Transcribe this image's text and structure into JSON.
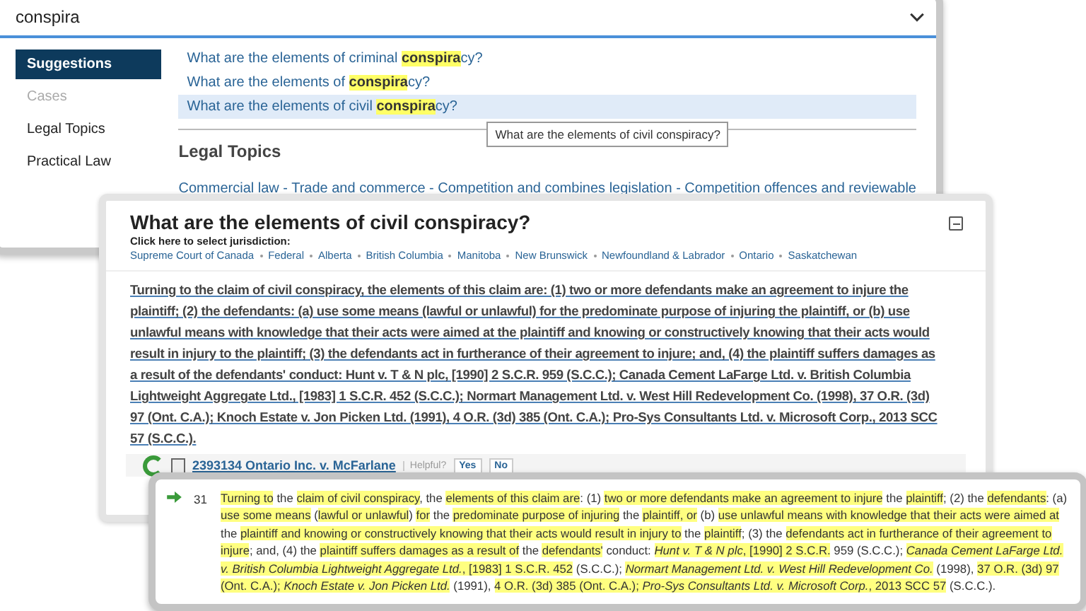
{
  "search_panel": {
    "query": "conspira",
    "categories": [
      {
        "label": "Suggestions",
        "selected": true,
        "disabled": false
      },
      {
        "label": "Cases",
        "selected": false,
        "disabled": true
      },
      {
        "label": "Legal Topics",
        "selected": false,
        "disabled": false
      },
      {
        "label": "Practical Law",
        "selected": false,
        "disabled": false
      }
    ],
    "suggestions": [
      {
        "before": "What are the elements of criminal ",
        "match": "conspira",
        "after": "cy?",
        "selected": false
      },
      {
        "before": "What are the elements of ",
        "match": "conspira",
        "after": "cy?",
        "selected": false
      },
      {
        "before": "What are the elements of civil ",
        "match": "conspira",
        "after": "cy?",
        "selected": true
      }
    ],
    "tooltip": "What are the elements of civil conspiracy?",
    "section_heading": "Legal Topics",
    "topic_link": "Commercial law - Trade and commerce - Competition and combines legislation - Competition offences and reviewable"
  },
  "answer_panel": {
    "title": "What are the elements of civil conspiracy?",
    "jurisdiction_prompt": "Click here to select jurisdiction:",
    "jurisdictions": [
      "Supreme Court of Canada",
      "Federal",
      "Alberta",
      "British Columbia",
      "Manitoba",
      "New Brunswick",
      "Newfoundland & Labrador",
      "Ontario",
      "Saskatchewan"
    ],
    "answer": "Turning to the claim of civil conspiracy, the elements of this claim are: (1) two or more defendants make an agreement to injure the plaintiff; (2) the defendants: (a) use some means (lawful or unlawful) for the predominate purpose of injuring the plaintiff, or (b) use unlawful means with knowledge that their acts were aimed at the plaintiff and knowing or constructively knowing that their acts would result in injury to the plaintiff; (3) the defendants act in furtherance of their agreement to injure; and, (4) the plaintiff suffers damages as a result of the defendants' conduct: Hunt v. T & N plc, [1990] 2 S.C.R. 959 (S.C.C.); Canada Cement LaFarge Ltd. v. British Columbia Lightweight Aggregate Ltd., [1983] 1 S.C.R. 452 (S.C.C.); Normart Management Ltd. v. West Hill Redevelopment Co. (1998), 37 O.R. (3d) 97 (Ont. C.A.); Knoch Estate v. Jon Picken Ltd. (1991), 4 O.R. (3d) 385 (Ont. C.A.); Pro-Sys Consultants Ltd. v. Microsoft Corp., 2013 SCC 57 (S.C.C.).",
    "source_case": "2393134 Ontario Inc. v. McFarlane",
    "helpful_label": "Helpful?",
    "feedback_buttons": [
      "Yes",
      "No"
    ]
  },
  "excerpt_panel": {
    "paragraph_number": "31",
    "segments": [
      {
        "text": "Turning to",
        "highlight": true
      },
      {
        "text": " the ",
        "highlight": false
      },
      {
        "text": "claim of civil conspiracy",
        "highlight": true
      },
      {
        "text": ", the ",
        "highlight": false
      },
      {
        "text": "elements of this claim are",
        "highlight": true
      },
      {
        "text": ": (1) ",
        "highlight": false
      },
      {
        "text": "two or more defendants make an agreement to injure",
        "highlight": true
      },
      {
        "text": " the ",
        "highlight": false
      },
      {
        "text": "plaintiff",
        "highlight": true
      },
      {
        "text": "; (2) the ",
        "highlight": false
      },
      {
        "text": "defendants",
        "highlight": true
      },
      {
        "text": ": (a) ",
        "highlight": false
      },
      {
        "text": "use some means",
        "highlight": true
      },
      {
        "text": " (",
        "highlight": false
      },
      {
        "text": "lawful or unlawful",
        "highlight": true
      },
      {
        "text": ") ",
        "highlight": false
      },
      {
        "text": "for",
        "highlight": true
      },
      {
        "text": " the ",
        "highlight": false
      },
      {
        "text": "predominate purpose of injuring",
        "highlight": true
      },
      {
        "text": " the ",
        "highlight": false
      },
      {
        "text": "plaintiff, or",
        "highlight": true
      },
      {
        "text": " (b) ",
        "highlight": false
      },
      {
        "text": "use unlawful means with knowledge that their acts were aimed at",
        "highlight": true
      },
      {
        "text": " the ",
        "highlight": false
      },
      {
        "text": "plaintiff and knowing or constructively knowing that their acts would result in injury to",
        "highlight": true
      },
      {
        "text": " the ",
        "highlight": false
      },
      {
        "text": "plaintiff",
        "highlight": true
      },
      {
        "text": "; (3) the ",
        "highlight": false
      },
      {
        "text": "defendants act in furtherance of their agreement to injure",
        "highlight": true
      },
      {
        "text": "; and, (4) the ",
        "highlight": false
      },
      {
        "text": "plaintiff suffers damages as a result of",
        "highlight": true
      },
      {
        "text": " the ",
        "highlight": false
      },
      {
        "text": "defendants'",
        "highlight": true
      },
      {
        "text": " conduct: ",
        "highlight": false
      },
      {
        "text": "*Hunt v. T & N plc*, [1990] 2 S.C.R.",
        "highlight": true
      },
      {
        "text": " 959 (S.C.C.); ",
        "highlight": false
      },
      {
        "text": "*Canada Cement LaFarge Ltd. v. British Columbia Lightweight Aggregate Ltd.*, [1983] 1 S.C.R. 452",
        "highlight": true
      },
      {
        "text": " (S.C.C.); ",
        "highlight": false
      },
      {
        "text": "*Normart Management Ltd. v. West Hill Redevelopment Co.*",
        "highlight": true
      },
      {
        "text": " (1998), ",
        "highlight": false
      },
      {
        "text": "37 O.R. (3d) 97 (Ont. C.A.); *Knoch Estate v. Jon Picken Ltd.*",
        "highlight": true
      },
      {
        "text": " (1991), ",
        "highlight": false
      },
      {
        "text": "4 O.R. (3d) 385 (Ont. C.A.); *Pro-Sys Consultants Ltd. v. Microsoft Corp.*, 2013 SCC 57",
        "highlight": true
      },
      {
        "text": " (S.C.C.).",
        "highlight": false
      }
    ]
  }
}
